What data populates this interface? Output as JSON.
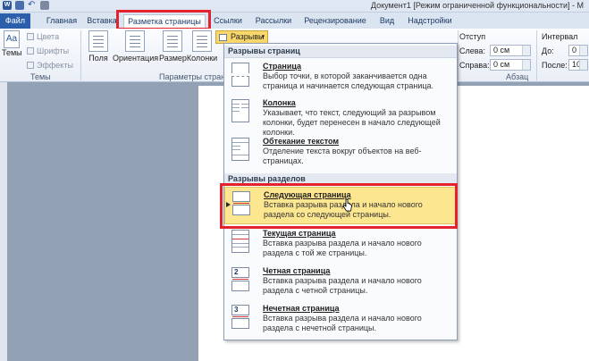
{
  "titlebar": {
    "title": "Документ1 [Режим ограниченной функциональности] - M"
  },
  "tabs": [
    {
      "label": "Файл"
    },
    {
      "label": "Главная"
    },
    {
      "label": "Вставка"
    },
    {
      "label": "Разметка страницы"
    },
    {
      "label": "Ссылки"
    },
    {
      "label": "Рассылки"
    },
    {
      "label": "Рецензирование"
    },
    {
      "label": "Вид"
    },
    {
      "label": "Надстройки"
    }
  ],
  "ribbon": {
    "themes": {
      "label": "Темы",
      "big_label": "Темы",
      "colors": "Цвета",
      "fonts": "Шрифты",
      "effects": "Эффекты"
    },
    "page_setup": {
      "label": "Параметры страни",
      "fields": "Поля",
      "orientation": "Ориентация",
      "size": "Размер",
      "columns": "Колонки"
    },
    "breaks_button": "Разрывы",
    "indent": {
      "label": "Отступ",
      "left_label": "Слева:",
      "left_value": "0 см",
      "right_label": "Справа:",
      "right_value": "0 см"
    },
    "spacing": {
      "label": "Интервал",
      "before_label": "До:",
      "before_value": "0",
      "after_label": "После:",
      "after_value": "10"
    },
    "paragraph_label": "Абзац"
  },
  "menu": {
    "section_page": "Разрывы страниц",
    "section_sections": "Разрывы разделов",
    "items": [
      {
        "title": "Страница",
        "desc": "Выбор точки, в которой заканчивается одна страница и начинается следующая страница."
      },
      {
        "title": "Колонка",
        "desc": "Указывает, что текст, следующий за разрывом колонки, будет перенесен в начало следующей колонки."
      },
      {
        "title": "Обтекание текстом",
        "desc": "Отделение текста вокруг объектов на веб-страницах."
      },
      {
        "title": "Следующая страница",
        "desc": "Вставка разрыва раздела и начало нового раздела со следующей страницы."
      },
      {
        "title": "Текущая страница",
        "desc": "Вставка разрыва раздела и начало нового раздела с той же страницы."
      },
      {
        "title": "Четная страница",
        "desc": "Вставка разрыва раздела и начало нового раздела с четной страницы."
      },
      {
        "title": "Нечетная страница",
        "desc": "Вставка разрыва раздела и начало нового раздела с нечетной страницы."
      }
    ],
    "badges": {
      "even": "2",
      "odd": "3"
    }
  },
  "colors": {
    "accent_red": "#e3232d",
    "highlight": "#fde690",
    "file_tab": "#2b5faa"
  },
  "icons": [
    "word-icon",
    "save-icon",
    "undo-icon",
    "print-icon",
    "page-break-icon",
    "column-break-icon",
    "text-wrap-icon",
    "next-page-icon",
    "continuous-icon",
    "even-page-icon",
    "odd-page-icon",
    "mouse-cursor-icon"
  ]
}
